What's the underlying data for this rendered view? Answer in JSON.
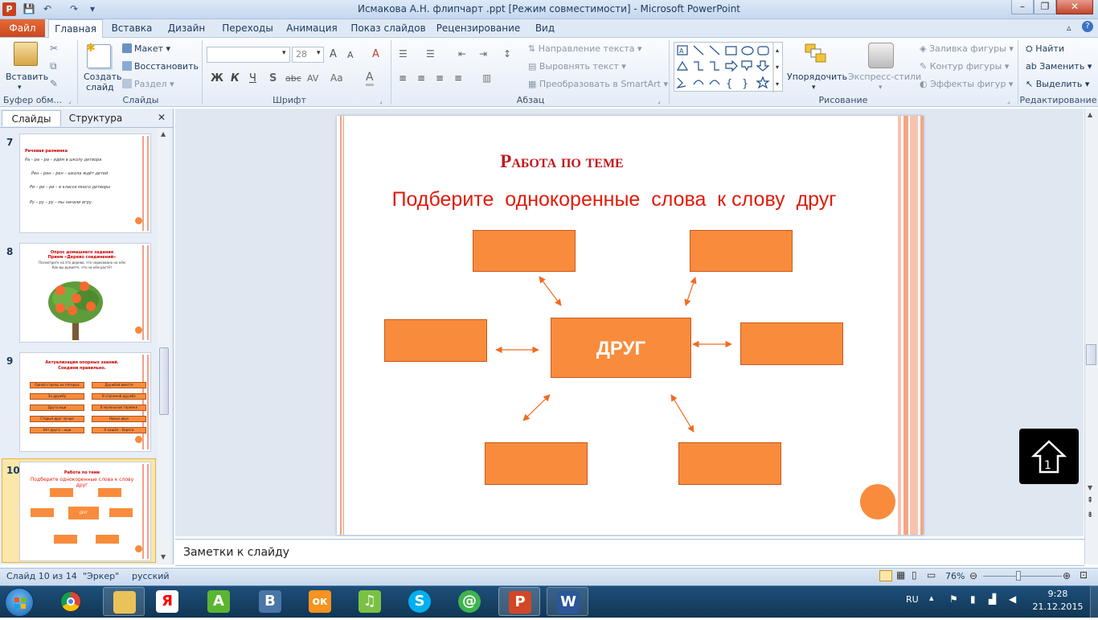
{
  "window": {
    "title": "Исмакова А.Н. флипчарт .ppt [Режим совместимости]  -  Microsoft PowerPoint",
    "app_letter": "P",
    "minimize": "–",
    "maximize": "❐",
    "close": "✕"
  },
  "qat": {
    "save": "💾",
    "undo": "↶",
    "redo": "↷",
    "customize": "▾"
  },
  "tabs": [
    "Файл",
    "Главная",
    "Вставка",
    "Дизайн",
    "Переходы",
    "Анимация",
    "Показ слайдов",
    "Рецензирование",
    "Вид"
  ],
  "ribbon": {
    "clipboard": {
      "paste": "Вставить",
      "label": "Буфер обм..."
    },
    "slides": {
      "new_slide_line1": "Создать",
      "new_slide_line2": "слайд",
      "layout": "Макет",
      "reset": "Восстановить",
      "section": "Раздел",
      "label": "Слайды"
    },
    "font": {
      "size": "28",
      "bold": "Ж",
      "italic": "К",
      "underline": "Ч",
      "shadow": "S",
      "strike": "abc",
      "spacing": "AV",
      "case": "Aa",
      "color": "A",
      "grow": "A",
      "shrink": "A",
      "clear": "A",
      "label": "Шрифт"
    },
    "paragraph": {
      "text_direction": "Направление текста",
      "align_text": "Выровнять текст",
      "smartart": "Преобразовать в SmartArt",
      "label": "Абзац"
    },
    "drawing": {
      "arrange": "Упорядочить",
      "quick_styles": "Экспресс-стили",
      "fill": "Заливка фигуры",
      "outline": "Контур фигуры",
      "effects": "Эффекты фигур",
      "label": "Рисование"
    },
    "editing": {
      "find": "Найти",
      "replace": "Заменить",
      "select": "Выделить",
      "label": "Редактирование"
    }
  },
  "left_pane": {
    "tab_slides": "Слайды",
    "tab_outline": "Структура",
    "close": "✕",
    "thumbs": [
      {
        "num": "7",
        "title": "Речевая разминка",
        "lines": [
          "Ра – ра – ра – идём в школу детвора",
          "Рен – рен – рен – школа ждёт детей",
          "Ри – ри – ри – в классе много детворы",
          "Ру – ру – ру – мы начали игру."
        ]
      },
      {
        "num": "8",
        "title": "Опрос домашнего задания",
        "subtitle": "Прием «Дерево соединений»",
        "lines": [
          "Посмотрите на это дерево, что нарисовано на нём",
          "Как вы думаете, что на нём растёт"
        ]
      },
      {
        "num": "9",
        "title": "Актуализация опорных знаний.",
        "subtitle": "Соедини правильно.",
        "cells": [
          "Одной стрелы на пятерых",
          "Дружбой вместе",
          "За дружбу",
          "В огромной дружбе",
          "Друга ищи",
          "В маленьком теремке",
          "Старый друг лучше",
          "Новых двух",
          "Нет друга – ищи",
          "А нашёл – береги"
        ]
      },
      {
        "num": "10",
        "title": "Работа по теме",
        "subtitle": "Подберите однокоренные слова к слову друг",
        "center": "ДРУГ"
      }
    ]
  },
  "slide": {
    "title": "Работа по теме",
    "subtitle": "Подберите  однокоренные  слова  к слову  друг",
    "center_word": "ДРУГ"
  },
  "notes_placeholder": "Заметки к слайду",
  "status": {
    "slide_info": "Слайд 10 из 14",
    "theme": "\"Эркер\"",
    "language": "русский",
    "zoom": "76%",
    "zoom_fraction": 0.45
  },
  "taskbar": {
    "apps": [
      "Chrome",
      "Проводник",
      "Я",
      "A",
      "B",
      "ок",
      "♫",
      "S",
      "@",
      "P",
      "W"
    ],
    "lang": "RU",
    "time": "9:28",
    "date": "21.12.2015"
  },
  "colors": {
    "accent_orange": "#f98c3c",
    "title_red": "#e11b0b",
    "ribbon_blue": "#1e395b"
  }
}
